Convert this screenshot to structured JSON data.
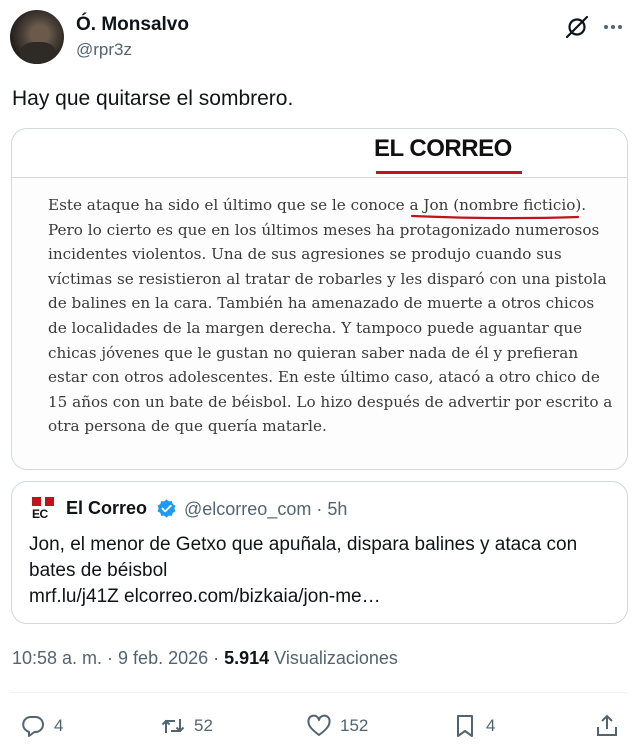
{
  "author": {
    "display_name": "Ó. Monsalvo",
    "handle": "@rpr3z"
  },
  "tweet": {
    "text": "Hay que quitarse el sombrero."
  },
  "image": {
    "logo": "EL CORREO",
    "paragraph_lines": [
      "Este ataque ha sido el último que se le conoce a Jon (nombre ficticio).",
      "Pero lo cierto es que en los últimos meses ha protagonizado numerosos",
      "incidentes violentos. Una de sus agresiones se produjo cuando sus",
      "víctimas se resistieron al tratar de robarles y les disparó con una pistola",
      "de balines en la cara. También ha amenazado de muerte a otros chicos",
      "de localidades de la margen derecha. Y tampoco puede aguantar que",
      "chicas jóvenes que le gustan no quieran saber nada de él y prefieran",
      "estar con otros adolescentes. En este último caso, atacó a otro chico de",
      "15 años con un bate de béisbol. Lo hizo después de advertir por escrito a",
      "otra persona de que quería matarle."
    ]
  },
  "quote": {
    "logo_text": "EC",
    "name": "El Correo",
    "handle_time": "@elcorreo_com · 5h",
    "text_line1": "Jon, el menor de Getxo que apuñala, dispara balines y ataca con",
    "text_line2": "bates de béisbol",
    "text_line3": "mrf.lu/j41Z elcorreo.com/bizkaia/jon-me…"
  },
  "meta": {
    "time_date": "10:58 a. m. · 9 feb. 2026 · ",
    "views_count": "5.914",
    "views_label": " Visualizaciones"
  },
  "actions": {
    "replies": "4",
    "retweets": "52",
    "likes": "152",
    "bookmarks": "4"
  },
  "icons": [
    "grok-icon",
    "more-icon",
    "verified-icon",
    "reply-icon",
    "retweet-icon",
    "like-icon",
    "bookmark-icon",
    "share-icon"
  ],
  "colors": {
    "text": "#0f1419",
    "secondary": "#536471",
    "border": "#cfd9de",
    "verified": "#1d9bf0",
    "correo_red": "#c2121b"
  }
}
